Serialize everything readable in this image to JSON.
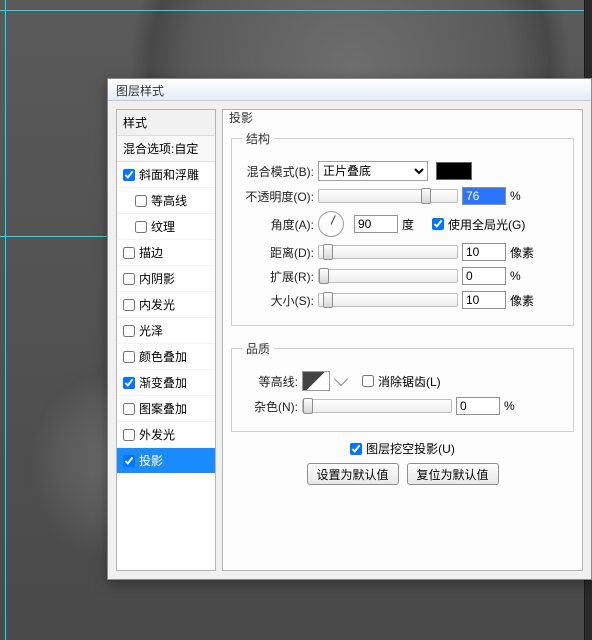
{
  "dialog": {
    "title": "图层样式"
  },
  "sidebar": {
    "header": "样式",
    "blend": "混合选项:自定",
    "items": [
      {
        "label": "斜面和浮雕",
        "checked": true,
        "selected": false,
        "indent": false
      },
      {
        "label": "等高线",
        "checked": false,
        "selected": false,
        "indent": true
      },
      {
        "label": "纹理",
        "checked": false,
        "selected": false,
        "indent": true
      },
      {
        "label": "描边",
        "checked": false,
        "selected": false,
        "indent": false
      },
      {
        "label": "内阴影",
        "checked": false,
        "selected": false,
        "indent": false
      },
      {
        "label": "内发光",
        "checked": false,
        "selected": false,
        "indent": false
      },
      {
        "label": "光泽",
        "checked": false,
        "selected": false,
        "indent": false
      },
      {
        "label": "颜色叠加",
        "checked": false,
        "selected": false,
        "indent": false
      },
      {
        "label": "渐变叠加",
        "checked": true,
        "selected": false,
        "indent": false
      },
      {
        "label": "图案叠加",
        "checked": false,
        "selected": false,
        "indent": false
      },
      {
        "label": "外发光",
        "checked": false,
        "selected": false,
        "indent": false
      },
      {
        "label": "投影",
        "checked": true,
        "selected": true,
        "indent": false
      }
    ]
  },
  "panel": {
    "title": "投影",
    "structure": {
      "legend": "结构",
      "blend_mode_label": "混合模式(B):",
      "blend_mode_value": "正片叠底",
      "opacity_label": "不透明度(O):",
      "opacity_value": "76",
      "opacity_unit": "%",
      "angle_label": "角度(A):",
      "angle_value": "90",
      "angle_unit": "度",
      "global_light_label": "使用全局光(G)",
      "global_light_checked": true,
      "distance_label": "距离(D):",
      "distance_value": "10",
      "distance_unit": "像素",
      "spread_label": "扩展(R):",
      "spread_value": "0",
      "spread_unit": "%",
      "size_label": "大小(S):",
      "size_value": "10",
      "size_unit": "像素"
    },
    "quality": {
      "legend": "品质",
      "contour_label": "等高线:",
      "antialias_label": "消除锯齿(L)",
      "antialias_checked": false,
      "noise_label": "杂色(N):",
      "noise_value": "0",
      "noise_unit": "%"
    },
    "knockout_label": "图层挖空投影(U)",
    "knockout_checked": true,
    "btn_default": "设置为默认值",
    "btn_reset": "复位为默认值"
  },
  "chart_data": {
    "type": "table",
    "title": "Drop Shadow settings",
    "rows": [
      {
        "param": "混合模式",
        "value": "正片叠底"
      },
      {
        "param": "不透明度",
        "value": 76,
        "unit": "%"
      },
      {
        "param": "角度",
        "value": 90,
        "unit": "度"
      },
      {
        "param": "使用全局光",
        "value": true
      },
      {
        "param": "距离",
        "value": 10,
        "unit": "像素"
      },
      {
        "param": "扩展",
        "value": 0,
        "unit": "%"
      },
      {
        "param": "大小",
        "value": 10,
        "unit": "像素"
      },
      {
        "param": "消除锯齿",
        "value": false
      },
      {
        "param": "杂色",
        "value": 0,
        "unit": "%"
      },
      {
        "param": "图层挖空投影",
        "value": true
      }
    ]
  }
}
